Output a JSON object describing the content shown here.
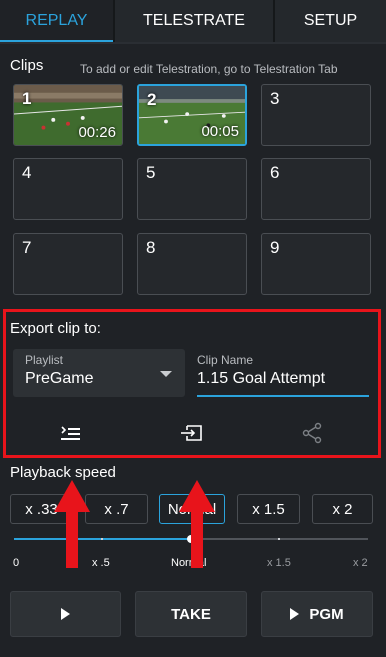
{
  "tabs": [
    {
      "label": "REPLAY",
      "active": true
    },
    {
      "label": "TELESTRATE",
      "active": false
    },
    {
      "label": "SETUP",
      "active": false
    }
  ],
  "clips": {
    "label": "Clips",
    "hint": "To add or edit Telestration, go to Telestration Tab",
    "slots": [
      {
        "number": "1",
        "duration": "00:26",
        "has_thumbnail": true
      },
      {
        "number": "2",
        "duration": "00:05",
        "has_thumbnail": true,
        "selected": true
      },
      {
        "number": "3"
      },
      {
        "number": "4"
      },
      {
        "number": "5"
      },
      {
        "number": "6"
      },
      {
        "number": "7"
      },
      {
        "number": "8"
      },
      {
        "number": "9"
      }
    ]
  },
  "export": {
    "label": "Export clip to:",
    "playlist_caption": "Playlist",
    "playlist_value": "PreGame",
    "clip_name_caption": "Clip Name",
    "clip_name_value": "1.15 Goal Attempt",
    "icons": [
      "playlist-add-icon",
      "export-input-icon",
      "share-icon"
    ]
  },
  "playback": {
    "label": "Playback speed",
    "options": [
      "x .33",
      "x .7",
      "Normal",
      "x 1.5",
      "x 2"
    ],
    "selected": "Normal",
    "slider_labels": [
      "0",
      "x .5",
      "Normal",
      "x 1.5",
      "x 2"
    ],
    "slider_value_fraction": 0.5
  },
  "buttons": {
    "play_icon": "play-icon",
    "take_label": "TAKE",
    "pgm_label": "PGM"
  },
  "colors": {
    "accent": "#2ba3dc",
    "highlight_box": "#e8141b",
    "background": "#1f2226"
  }
}
